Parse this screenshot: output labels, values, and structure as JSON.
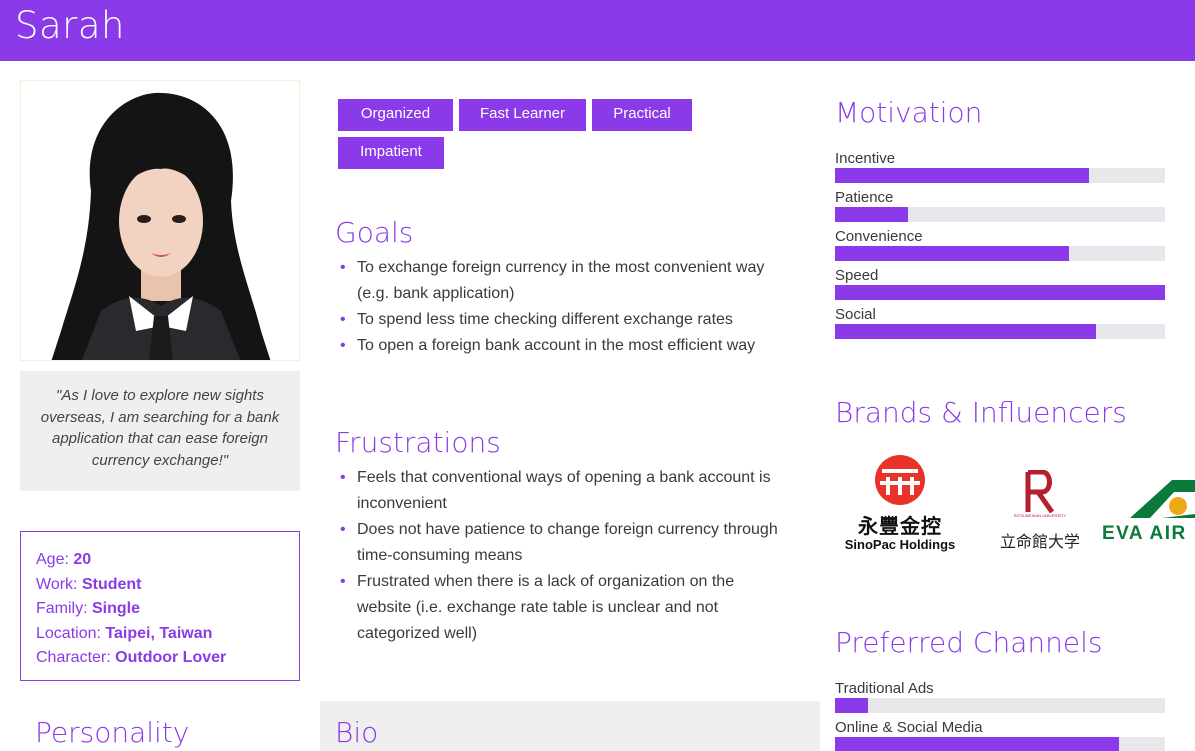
{
  "persona": {
    "name": "Sarah"
  },
  "quote": "\"As I love to explore new sights overseas, I am searching for a bank application that can ease foreign currency exchange!\"",
  "info": [
    {
      "label": "Age: ",
      "value": "20"
    },
    {
      "label": "Work: ",
      "value": "Student"
    },
    {
      "label": "Family: ",
      "value": "Single"
    },
    {
      "label": "Location: ",
      "value": "Taipei, Taiwan"
    },
    {
      "label": "Character: ",
      "value": "Outdoor Lover"
    }
  ],
  "personality_title": "Personality",
  "tags": [
    "Organized",
    "Fast Learner",
    "Practical",
    "Impatient"
  ],
  "goals": {
    "title": "Goals",
    "items": [
      "To exchange foreign currency in the most convenient way (e.g. bank application)",
      "To spend less time checking different exchange rates",
      "To open a foreign bank account in the most efficient way"
    ]
  },
  "frustrations": {
    "title": "Frustrations",
    "items": [
      "Feels that conventional ways of opening a bank account is inconvenient",
      "Does not have patience to change foreign currency through time-consuming means",
      "Frustrated when there is a lack of organization on the website (i.e. exchange rate table is unclear and not categorized well)"
    ]
  },
  "bio_title": "Bio",
  "motivation": {
    "title": "Motivation",
    "items": [
      {
        "label": "Incentive",
        "level": 0.77
      },
      {
        "label": "Patience",
        "level": 0.22
      },
      {
        "label": "Convenience",
        "level": 0.71
      },
      {
        "label": "Speed",
        "level": 1.0
      },
      {
        "label": "Social",
        "level": 0.79
      }
    ]
  },
  "brands": {
    "title": "Brands & Influencers",
    "sinopac": {
      "chinese": "永豐金控",
      "english": "SinoPac Holdings"
    },
    "ritsumeikan": {
      "chinese": "立命館大学",
      "small": "RITSUMEIKAN UNIVERSITY"
    },
    "eva": {
      "name": "EVA AIR"
    }
  },
  "channels": {
    "title": "Preferred Channels",
    "items": [
      {
        "label": "Traditional Ads",
        "level": 0.1
      },
      {
        "label": "Online & Social Media",
        "level": 0.86
      }
    ]
  },
  "colors": {
    "accent": "#8a3ae8",
    "track": "#e8e8ec",
    "panel": "#efefef"
  }
}
